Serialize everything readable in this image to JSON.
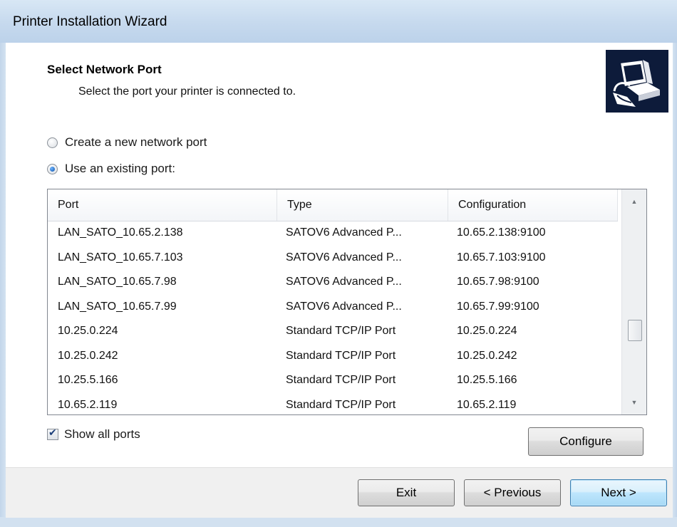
{
  "window": {
    "title": "Printer Installation Wizard"
  },
  "page": {
    "heading": "Select Network Port",
    "subheading": "Select the port your printer is connected to."
  },
  "options": {
    "create_new_label": "Create a new network port",
    "use_existing_label": "Use an existing port:",
    "selected": "use_existing"
  },
  "ports_table": {
    "columns": [
      "Port",
      "Type",
      "Configuration"
    ],
    "rows": [
      {
        "port": "LAN_SATO_10.65.2.138",
        "type": "SATOV6 Advanced P...",
        "configuration": "10.65.2.138:9100"
      },
      {
        "port": "LAN_SATO_10.65.7.103",
        "type": "SATOV6 Advanced P...",
        "configuration": "10.65.7.103:9100"
      },
      {
        "port": "LAN_SATO_10.65.7.98",
        "type": "SATOV6 Advanced P...",
        "configuration": "10.65.7.98:9100"
      },
      {
        "port": "LAN_SATO_10.65.7.99",
        "type": "SATOV6 Advanced P...",
        "configuration": "10.65.7.99:9100"
      },
      {
        "port": "10.25.0.224",
        "type": "Standard TCP/IP Port",
        "configuration": "10.25.0.224"
      },
      {
        "port": "10.25.0.242",
        "type": "Standard TCP/IP Port",
        "configuration": "10.25.0.242"
      },
      {
        "port": "10.25.5.166",
        "type": "Standard TCP/IP Port",
        "configuration": "10.25.5.166"
      },
      {
        "port": "10.65.2.119",
        "type": "Standard TCP/IP Port",
        "configuration": "10.65.2.119"
      }
    ]
  },
  "show_all_ports": {
    "label": "Show all ports",
    "checked": true
  },
  "buttons": {
    "configure": "Configure",
    "exit": "Exit",
    "previous": "< Previous",
    "next": "Next >"
  },
  "icons": {
    "wizard_graphic": "printer-computer-icon",
    "scroll_up": "triangle-up-icon",
    "scroll_down": "triangle-down-icon",
    "checkmark": "checkmark-icon"
  },
  "colors": {
    "titlebar": "#c6d9ee",
    "default_button": "#3c7fb1",
    "graphic_background": "#0d1b3a",
    "button_bar": "#f0f0f0"
  }
}
